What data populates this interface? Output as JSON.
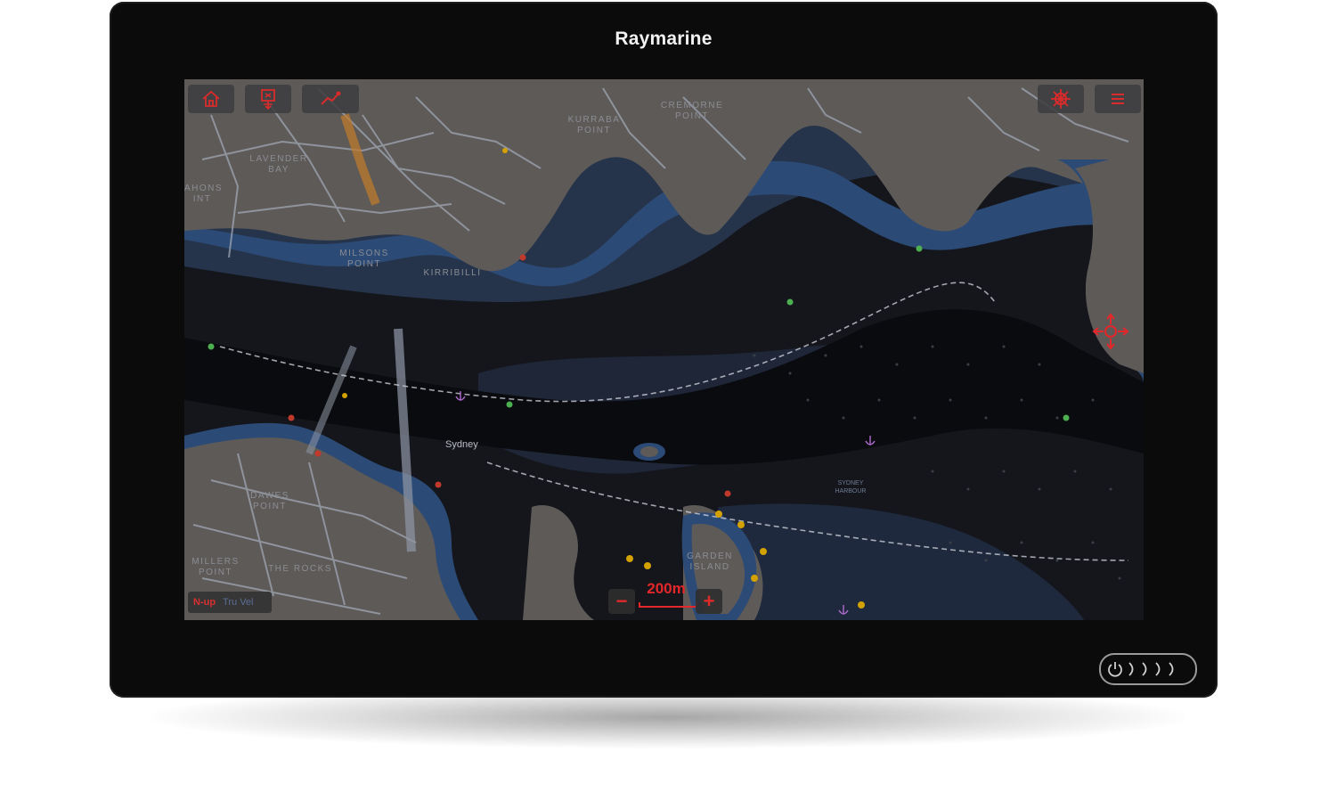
{
  "device": {
    "brand": "Raymarine",
    "power_button_icon": "power-icon",
    "touch_arcs": 4
  },
  "toolbar": {
    "left_buttons": [
      {
        "name": "home-button",
        "icon": "home-icon"
      },
      {
        "name": "waypoint-button",
        "icon": "mob-waypoint-icon"
      },
      {
        "name": "route-button",
        "icon": "route-icon"
      }
    ],
    "right_buttons": [
      {
        "name": "pilot-button",
        "icon": "helm-wheel-icon"
      },
      {
        "name": "menu-button",
        "icon": "hamburger-menu-icon"
      }
    ]
  },
  "map": {
    "area_labels": {
      "lavender_bay": "LAVENDER\nBAY",
      "mahons_point": "AHONS\nINT",
      "kurraba_point": "KURRABA\nPOINT",
      "cremorne_point": "CREMORNE\nPOINT",
      "milsons_point": "MILSONS\nPOINT",
      "kirribilli": "KIRRIBILLI",
      "dawes_point": "DAWES\nPOINT",
      "millers_point": "MILLERS\nPOINT",
      "the_rocks": "THE ROCKS",
      "garden_island": "GARDEN\nISLAND",
      "sydney_harbour": "SYDNEY\nHARBOUR"
    },
    "place_name": "Sydney",
    "orientation": "N-up",
    "motion_mode": "Tru Vel",
    "scale": "200m",
    "zoom_out_label": "−",
    "zoom_in_label": "+",
    "colors": {
      "land": "#5e5a58",
      "deep_water": "#14161c",
      "shallow_water": "#26344b",
      "coast_band": "#2c4a76",
      "accent": "#e4272a"
    }
  }
}
